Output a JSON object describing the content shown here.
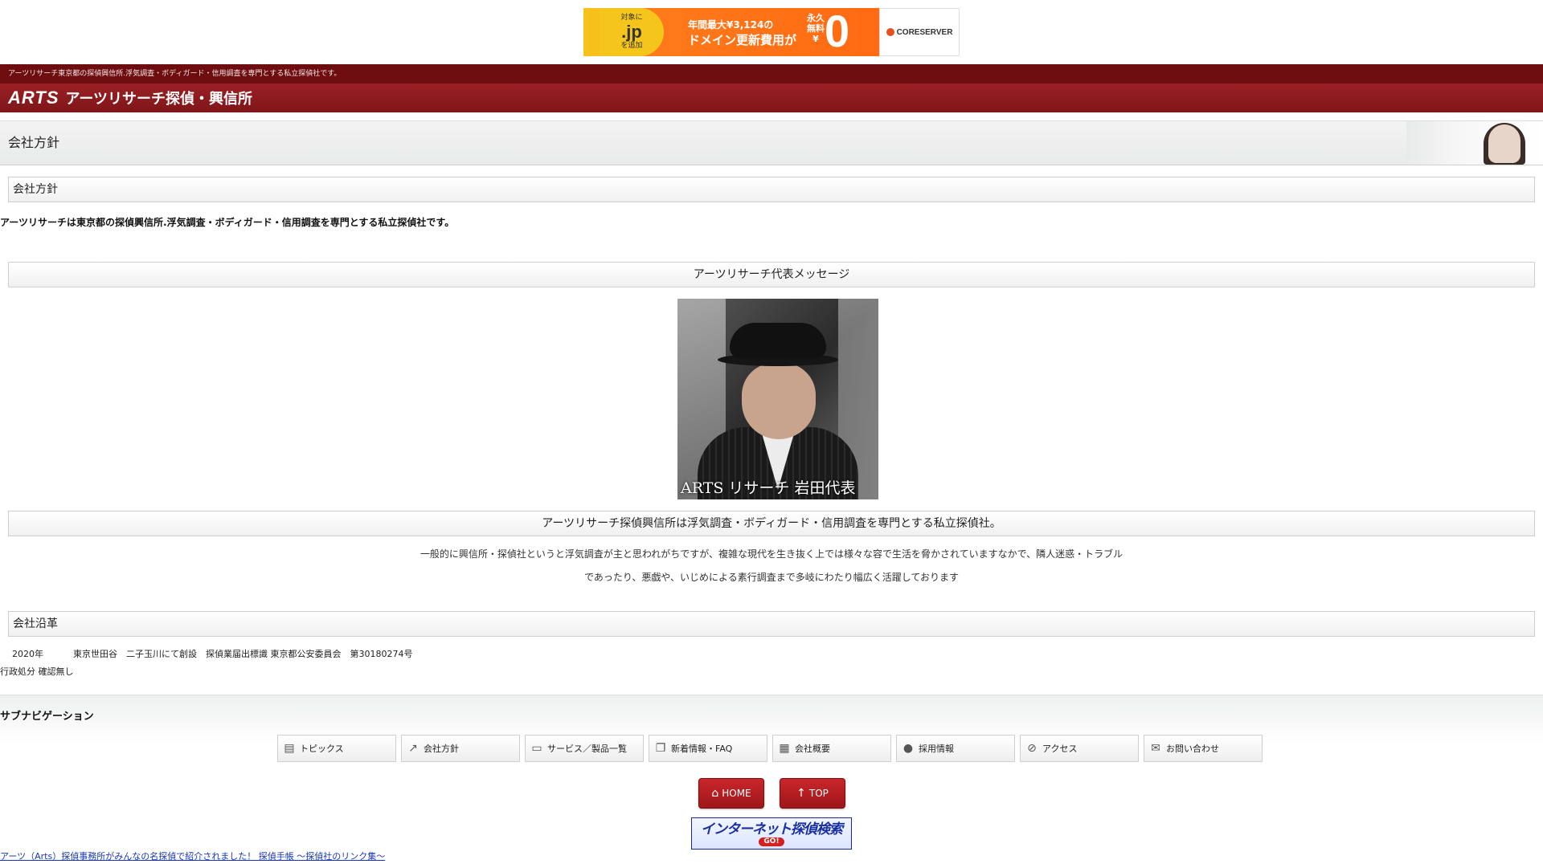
{
  "ad": {
    "jp_top": "対象に",
    "jp_domain": ".jp",
    "jp_bottom": "を追加",
    "line1": "年間最大¥3,124の",
    "line2": "ドメイン更新費用が",
    "free_label": "永久\n無料\n¥",
    "zero": "0",
    "brand": "CORESERVER"
  },
  "header": {
    "tagline": "アーツリサーチ東京都の探偵興信所.浮気調査・ボディガード・信用調査を専門とする私立探偵社です。",
    "logo_en": "ARTS",
    "logo_jp": "アーツリサーチ探偵・興信所"
  },
  "page": {
    "title": "会社方針"
  },
  "sections": {
    "policy_heading": "会社方針",
    "policy_text": "アーツリサーチは東京都の探偵興信所.浮気調査・ボディガード・信用調査を専門とする私立探偵社です。",
    "message_heading": "アーツリサーチ代表メッセージ",
    "portrait_caption": "ARTS リサーチ 岩田代表",
    "specialty_heading": "アーツリサーチ探偵興信所は浮気調査・ボディガード・信用調査を専門とする私立探偵社。",
    "paragraph_line1": "一般的に興信所・探偵社というと浮気調査が主と思われがちですが、複雑な現代を生き抜く上では様々な容で生活を脅かされていますなかで、隣人迷惑・トラブル",
    "paragraph_line2": "であったり、悪戯や、いじめによる素行調査まで多岐にわたり幅広く活躍しております",
    "history_heading": "会社沿革",
    "history_year": "2020年",
    "history_text": "東京世田谷　二子玉川にて創設　探偵業届出標識 東京都公安委員会　第30180274号",
    "admin_note": "行政処分 確認無し"
  },
  "subnav": {
    "title": "サブナビゲーション",
    "items": [
      {
        "label": "トピックス",
        "icon": "speech-icon"
      },
      {
        "label": "会社方針",
        "icon": "chart-icon"
      },
      {
        "label": "サービス／製品一覧",
        "icon": "monitor-icon"
      },
      {
        "label": "新着情報・FAQ",
        "icon": "window-icon"
      },
      {
        "label": "会社概要",
        "icon": "building-icon"
      },
      {
        "label": "採用情報",
        "icon": "person-icon"
      },
      {
        "label": "アクセス",
        "icon": "compass-icon"
      },
      {
        "label": "お問い合わせ",
        "icon": "mail-icon"
      }
    ],
    "home_label": "HOME",
    "top_label": "TOP"
  },
  "banner": {
    "text": "インターネット探偵検索",
    "go": "GO!"
  },
  "footer": {
    "link_text": "アーツ（Arts）探偵事務所がみんなの名探偵で紹介されました！ 探偵手帳 ～探偵社のリンク集～"
  },
  "colors": {
    "header_dark": "#6e0d0f",
    "header_red": "#8b1a1d",
    "button_red": "#b51e22",
    "link_blue": "#1a37b5"
  }
}
